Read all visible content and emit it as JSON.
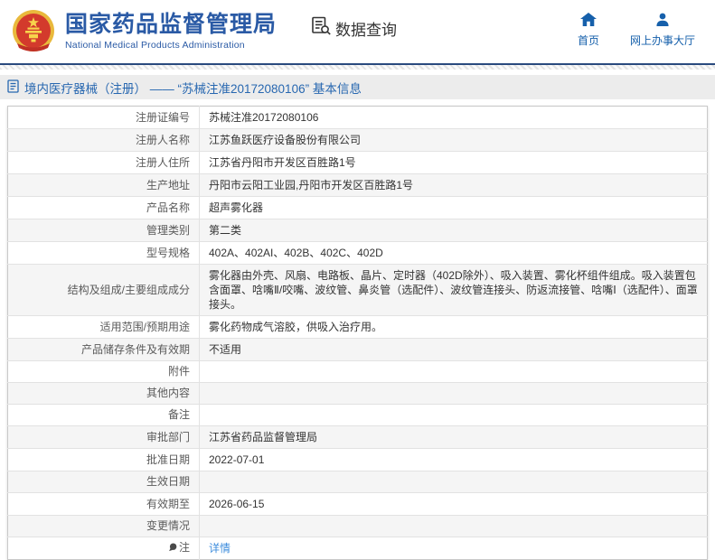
{
  "header": {
    "logo_title": "国家药品监督管理局",
    "logo_subtitle": "National Medical Products Administration",
    "section_label": "数据查询",
    "nav": [
      {
        "label": "首页",
        "icon": "home-icon"
      },
      {
        "label": "网上办事大厅",
        "icon": "user-icon"
      }
    ]
  },
  "breadcrumb": {
    "text": "境内医疗器械（注册） —— “苏械注准20172080106” 基本信息"
  },
  "colors": {
    "brand_blue": "#2a5aa5",
    "nav_blue": "#1660ab",
    "crumb_text_blue": "#2767b0",
    "crumb_bar_bg": "#ececec",
    "link_blue": "#3e8ddd",
    "stripe_gray": "#f5f5f5",
    "emblem_red": "#d33a2c",
    "emblem_gold": "#f2c443"
  },
  "table": {
    "rows": [
      {
        "label": "注册证编号",
        "value": "苏械注准20172080106"
      },
      {
        "label": "注册人名称",
        "value": "江苏鱼跃医疗设备股份有限公司"
      },
      {
        "label": "注册人住所",
        "value": "江苏省丹阳市开发区百胜路1号"
      },
      {
        "label": "生产地址",
        "value": "丹阳市云阳工业园,丹阳市开发区百胜路1号"
      },
      {
        "label": "产品名称",
        "value": "超声雾化器"
      },
      {
        "label": "管理类别",
        "value": "第二类"
      },
      {
        "label": "型号规格",
        "value": "402A、402AI、402B、402C、402D"
      },
      {
        "label": "结构及组成/主要组成成分",
        "value": "雾化器由外壳、风扇、电路板、晶片、定时器（402D除外）、吸入装置、雾化杯组件组成。吸入装置包含面罩、唅嘴Ⅱ/咬嘴、波纹管、鼻炎管（选配件）、波纹管连接头、防返流接管、唅嘴Ⅰ（选配件）、面罩接头。"
      },
      {
        "label": "适用范围/预期用途",
        "value": "雾化药物成气溶胶，供吸入治疗用。"
      },
      {
        "label": "产品储存条件及有效期",
        "value": "不适用"
      },
      {
        "label": "附件",
        "value": ""
      },
      {
        "label": "其他内容",
        "value": ""
      },
      {
        "label": "备注",
        "value": ""
      },
      {
        "label": "审批部门",
        "value": "江苏省药品监督管理局"
      },
      {
        "label": "批准日期",
        "value": "2022-07-01"
      },
      {
        "label": "生效日期",
        "value": ""
      },
      {
        "label": "有效期至",
        "value": "2026-06-15"
      },
      {
        "label": "变更情况",
        "value": ""
      },
      {
        "label": "注",
        "value": "详情",
        "note_icon": true,
        "link": true
      }
    ]
  }
}
